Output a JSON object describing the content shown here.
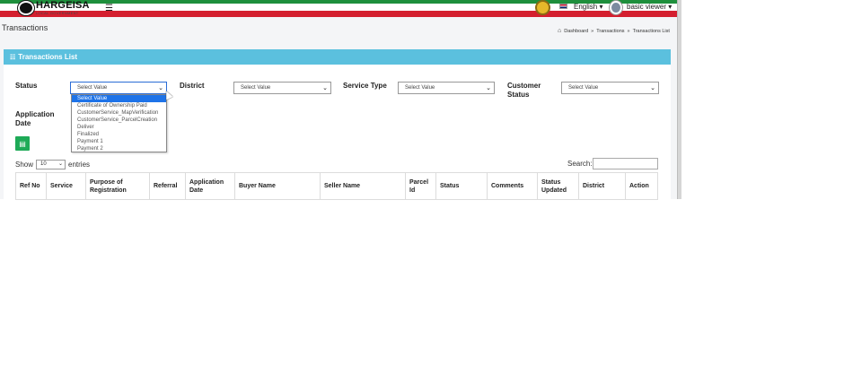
{
  "header": {
    "brand_title": "HARGEISA",
    "brand_subtitle": "LOCAL GOVERNMENT",
    "menu_icon": "hamburger-icon",
    "language": "English",
    "user": "basic viewer",
    "colors": {
      "green": "#1e8f3c",
      "red": "#d41f2f",
      "panel": "#5bc0de"
    }
  },
  "page": {
    "title": "Transactions",
    "breadcrumb": [
      "Dashboard",
      "»",
      "Transactions",
      "»",
      "Transactions List"
    ]
  },
  "panel": {
    "title": "Transactions List",
    "filters": {
      "status_label": "Status",
      "status_value": "Select Value",
      "district_label": "District",
      "district_value": "Select Value",
      "service_type_label": "Service Type",
      "service_type_value": "Select Value",
      "customer_status_label": [
        "Customer",
        "Status"
      ],
      "customer_status_value": "Select Value",
      "application_date_label": [
        "Application",
        "Date"
      ]
    },
    "status_options": [
      "Select Value",
      "Certificate of Ownership Paid",
      "CustomerService_MapVerification",
      "CustomerService_ParcelCreation",
      "Deliver",
      "Finalized",
      "Payment 1",
      "Payment 2"
    ],
    "length": {
      "show": "Show",
      "value": "10",
      "entries": "entries"
    },
    "search_label": "Search:",
    "columns": [
      [
        "Ref No"
      ],
      [
        "Service"
      ],
      [
        "Purpose of",
        "Registration"
      ],
      [
        "Referral"
      ],
      [
        "Application",
        "Date"
      ],
      [
        "Buyer Name"
      ],
      [
        "Seller Name"
      ],
      [
        "Parcel",
        "Id"
      ],
      [
        "Status"
      ],
      [
        "Comments"
      ],
      [
        "Status",
        "Updated"
      ],
      [
        "District"
      ],
      [
        "Action"
      ]
    ]
  }
}
